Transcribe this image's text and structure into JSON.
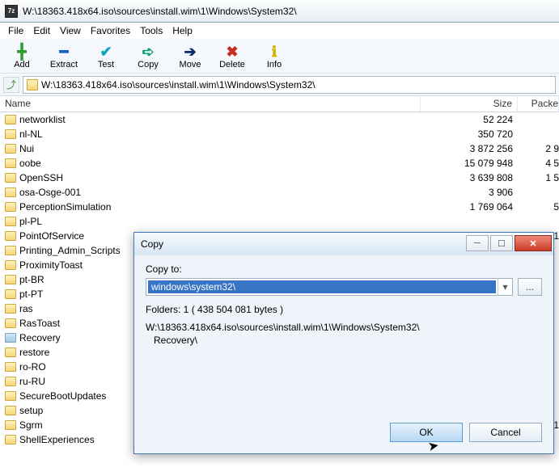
{
  "window": {
    "title": "W:\\18363.418x64.iso\\sources\\install.wim\\1\\Windows\\System32\\",
    "appicon_text": "7z"
  },
  "menu": {
    "file": "File",
    "edit": "Edit",
    "view": "View",
    "favorites": "Favorites",
    "tools": "Tools",
    "help": "Help"
  },
  "toolbar": {
    "add": "Add",
    "extract": "Extract",
    "test": "Test",
    "copy": "Copy",
    "move": "Move",
    "delete": "Delete",
    "info": "Info"
  },
  "address": {
    "path": "W:\\18363.418x64.iso\\sources\\install.wim\\1\\Windows\\System32\\"
  },
  "columns": {
    "name": "Name",
    "size": "Size",
    "packed": "Packe"
  },
  "rows": [
    {
      "name": "networklist",
      "size": "52 224",
      "packed": ""
    },
    {
      "name": "nl-NL",
      "size": "350 720",
      "packed": ""
    },
    {
      "name": "Nui",
      "size": "3 872 256",
      "packed": "2 9"
    },
    {
      "name": "oobe",
      "size": "15 079 948",
      "packed": "4 5"
    },
    {
      "name": "OpenSSH",
      "size": "3 639 808",
      "packed": "1 5"
    },
    {
      "name": "osa-Osge-001",
      "size": "3 906",
      "packed": ""
    },
    {
      "name": "PerceptionSimulation",
      "size": "1 769 064",
      "packed": "5"
    },
    {
      "name": "pl-PL",
      "size": "",
      "packed": ""
    },
    {
      "name": "PointOfService",
      "size": "",
      "packed": "1"
    },
    {
      "name": "Printing_Admin_Scripts",
      "size": "",
      "packed": ""
    },
    {
      "name": "ProximityToast",
      "size": "",
      "packed": ""
    },
    {
      "name": "pt-BR",
      "size": "",
      "packed": ""
    },
    {
      "name": "pt-PT",
      "size": "",
      "packed": ""
    },
    {
      "name": "ras",
      "size": "",
      "packed": ""
    },
    {
      "name": "RasToast",
      "size": "",
      "packed": ""
    },
    {
      "name": "Recovery",
      "size": "",
      "packed": "",
      "recov": true
    },
    {
      "name": "restore",
      "size": "",
      "packed": ""
    },
    {
      "name": "ro-RO",
      "size": "",
      "packed": ""
    },
    {
      "name": "ru-RU",
      "size": "",
      "packed": ""
    },
    {
      "name": "SecureBootUpdates",
      "size": "",
      "packed": ""
    },
    {
      "name": "setup",
      "size": "",
      "packed": ""
    },
    {
      "name": "Sgrm",
      "size": "",
      "packed": "1"
    },
    {
      "name": "ShellExperiences",
      "size": "",
      "packed": ""
    }
  ],
  "dialog": {
    "title": "Copy",
    "label": "Copy to:",
    "value": "windows\\system32\\",
    "browse": "...",
    "info": "Folders: 1    ( 438 504 081 bytes )",
    "src_line1": "W:\\18363.418x64.iso\\sources\\install.wim\\1\\Windows\\System32\\",
    "src_line2": "Recovery\\",
    "ok": "OK",
    "cancel": "Cancel"
  }
}
